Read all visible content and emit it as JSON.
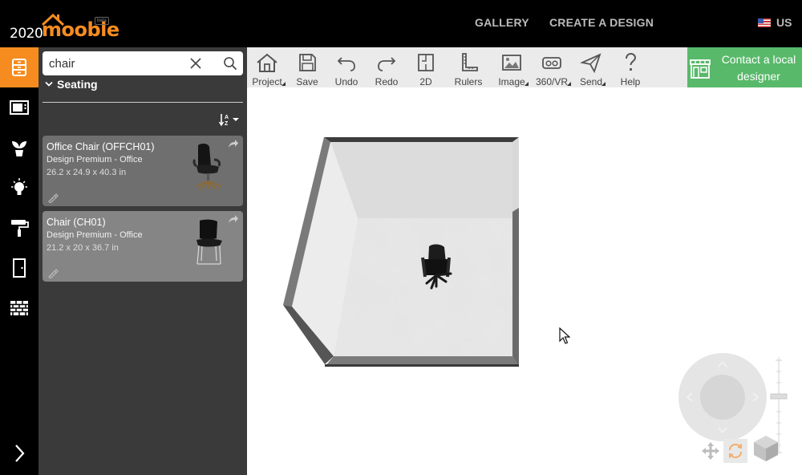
{
  "header": {
    "logo_number": "2020",
    "logo_brand": "mooble",
    "logo_badge": "beta",
    "nav": {
      "gallery": "GALLERY",
      "create": "CREATE A DESIGN"
    },
    "region": "US"
  },
  "rail": {
    "items": [
      "furniture-icon",
      "appliances-icon",
      "plants-icon",
      "lighting-icon",
      "paint-icon",
      "doors-icon",
      "walls-icon"
    ],
    "active": "furniture-icon",
    "expand": "chevron-right-icon"
  },
  "catalog": {
    "search": {
      "value": "chair",
      "placeholder": ""
    },
    "category": "Seating",
    "products": [
      {
        "title": "Office Chair (OFFCH01)",
        "brand": "Design Premium - Office",
        "dimensions": "26.2 x 24.9 x 40.3 in"
      },
      {
        "title": "Chair (CH01)",
        "brand": "Design Premium - Office",
        "dimensions": "21.2 x 20 x 36.7 in"
      }
    ]
  },
  "toolbar": {
    "project": "Project",
    "save": "Save",
    "undo": "Undo",
    "redo": "Redo",
    "view2d": "2D",
    "rulers": "Rulers",
    "image": "Image",
    "vr": "360/VR",
    "send": "Send",
    "help": "Help"
  },
  "contact": {
    "line1": "Contact a local",
    "line2": "designer"
  },
  "colors": {
    "accent": "#f68c1f",
    "contact": "#58b96a",
    "panel": "#3a3a3a",
    "topbar": "#000000"
  }
}
